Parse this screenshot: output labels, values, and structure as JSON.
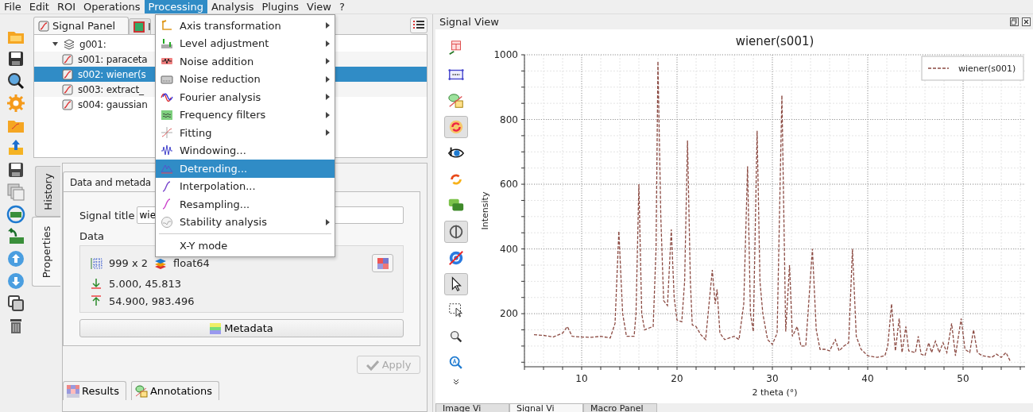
{
  "menubar": [
    {
      "label": "File",
      "selected": false
    },
    {
      "label": "Edit",
      "selected": false
    },
    {
      "label": "ROI",
      "selected": false
    },
    {
      "label": "Operations",
      "selected": false
    },
    {
      "label": "Processing",
      "selected": true
    },
    {
      "label": "Analysis",
      "selected": false
    },
    {
      "label": "Plugins",
      "selected": false
    },
    {
      "label": "View",
      "selected": false
    },
    {
      "label": "?",
      "selected": false
    }
  ],
  "processing_menu": {
    "items": [
      {
        "kind": "submenu",
        "label": "Axis transformation",
        "selected": false
      },
      {
        "kind": "submenu",
        "label": "Level adjustment",
        "selected": false
      },
      {
        "kind": "submenu",
        "label": "Noise addition",
        "selected": false
      },
      {
        "kind": "submenu",
        "label": "Noise reduction",
        "selected": false
      },
      {
        "kind": "submenu",
        "label": "Fourier analysis",
        "selected": false
      },
      {
        "kind": "submenu",
        "label": "Frequency filters",
        "selected": false
      },
      {
        "kind": "submenu",
        "label": "Fitting",
        "selected": false
      },
      {
        "kind": "action",
        "label": "Windowing...",
        "selected": false
      },
      {
        "kind": "action",
        "label": "Detrending...",
        "selected": true
      },
      {
        "kind": "action",
        "label": "Interpolation...",
        "selected": false
      },
      {
        "kind": "action",
        "label": "Resampling...",
        "selected": false
      },
      {
        "kind": "submenu",
        "label": "Stability analysis",
        "selected": false
      },
      {
        "kind": "separator"
      },
      {
        "kind": "action",
        "label": "X-Y mode",
        "selected": false
      }
    ]
  },
  "left_panel": {
    "tabs": [
      {
        "label": "Signal Panel",
        "selected": true
      },
      {
        "label": "I",
        "selected": false
      }
    ],
    "tree": {
      "label": "g001:",
      "expanded": true,
      "children": [
        {
          "label": "s001: paraceta",
          "selected": false
        },
        {
          "label": "s002: wiener(s",
          "selected": true
        },
        {
          "label": "s003: extract_",
          "selected": false
        },
        {
          "label": "s004: gaussian",
          "selected": false
        }
      ]
    },
    "side_tabs": [
      {
        "label": "History",
        "selected": false
      },
      {
        "label": "Properties",
        "selected": true
      }
    ],
    "properties": {
      "group_title": "Data and metada",
      "signal_title_label": "Signal title",
      "signal_title_value": "wie",
      "data_label": "Data",
      "shape": "999 x 2",
      "dtype": "float64",
      "min": "5.000, 45.813",
      "max": "54.900, 983.496",
      "metadata_button": "Metadata",
      "apply_button": {
        "label": "Apply",
        "disabled": true
      }
    },
    "bottom_buttons": [
      "Results",
      "Annotations"
    ]
  },
  "signal_view": {
    "title": "Signal View",
    "plot_tools": [
      {
        "checked": false
      },
      {
        "checked": false
      },
      {
        "checked": false
      },
      {
        "checked": true
      },
      {
        "checked": false
      },
      {
        "checked": false
      },
      {
        "checked": false
      },
      {
        "checked": true
      },
      {
        "checked": false
      },
      {
        "checked": true
      },
      {
        "checked": false
      },
      {
        "checked": false
      },
      {
        "checked": false
      }
    ],
    "chart_data": {
      "type": "line",
      "title": "wiener(s001)",
      "xlabel": "2 theta (°)",
      "ylabel": "Intensity",
      "x": [
        5,
        6,
        7,
        8,
        8.5,
        9,
        10,
        11,
        12,
        13,
        13.5,
        13.9,
        14.3,
        14.7,
        15.5,
        15.7,
        16,
        16.3,
        16.6,
        17,
        17.5,
        17.8,
        18,
        18.3,
        18.6,
        19,
        19.4,
        19.7,
        20,
        20.5,
        20.8,
        21.1,
        21.4,
        21.6,
        22,
        22.5,
        23,
        23.7,
        24,
        24.2,
        24.5,
        25,
        25.5,
        26,
        26.5,
        27,
        27.4,
        27.7,
        28,
        28.4,
        28.7,
        29,
        29.5,
        30,
        30.5,
        31,
        31.4,
        31.8,
        32.1,
        32.6,
        33,
        33.5,
        34.2,
        34.6,
        35,
        35.5,
        36,
        36.6,
        37,
        37.5,
        38,
        38.4,
        38.8,
        39.3,
        40,
        41,
        41.8,
        42.1,
        42.5,
        42.9,
        43.3,
        43.6,
        44,
        44.3,
        45,
        45.3,
        45.6,
        46,
        46.4,
        46.7,
        47.1,
        47.5,
        47.9,
        48.3,
        48.8,
        49.2,
        49.8,
        50.2,
        50.7,
        51.1,
        51.5,
        52,
        53,
        53.5,
        54,
        54.5,
        55
      ],
      "series": [
        {
          "name": "wiener(s001)",
          "color": "#8b4a42",
          "line_style": "dashed",
          "values": [
            135,
            133,
            128,
            140,
            160,
            130,
            128,
            127,
            130,
            125,
            170,
            455,
            200,
            130,
            130,
            200,
            600,
            200,
            150,
            155,
            160,
            400,
            980,
            500,
            240,
            225,
            460,
            250,
            180,
            175,
            300,
            735,
            300,
            165,
            160,
            135,
            120,
            335,
            230,
            275,
            140,
            120,
            125,
            130,
            120,
            230,
            655,
            200,
            145,
            765,
            300,
            200,
            120,
            105,
            140,
            875,
            145,
            350,
            130,
            160,
            100,
            100,
            400,
            150,
            90,
            90,
            85,
            120,
            85,
            100,
            110,
            400,
            130,
            90,
            70,
            65,
            70,
            100,
            230,
            85,
            185,
            80,
            160,
            85,
            80,
            130,
            75,
            70,
            110,
            80,
            115,
            80,
            110,
            80,
            170,
            70,
            185,
            90,
            80,
            150,
            80,
            70,
            65,
            75,
            65,
            80,
            50
          ]
        }
      ],
      "grid": true,
      "xlim": [
        4,
        56.5
      ],
      "ylim": [
        36,
        1000
      ],
      "xticks": [
        10,
        20,
        30,
        40,
        50
      ],
      "yticks": [
        200,
        400,
        600,
        800,
        1000
      ]
    },
    "bottom_tabs": [
      {
        "label": "Image Vi",
        "selected": false
      },
      {
        "label": "Signal Vi",
        "selected": true
      },
      {
        "label": "Macro Panel",
        "selected": false
      }
    ]
  }
}
